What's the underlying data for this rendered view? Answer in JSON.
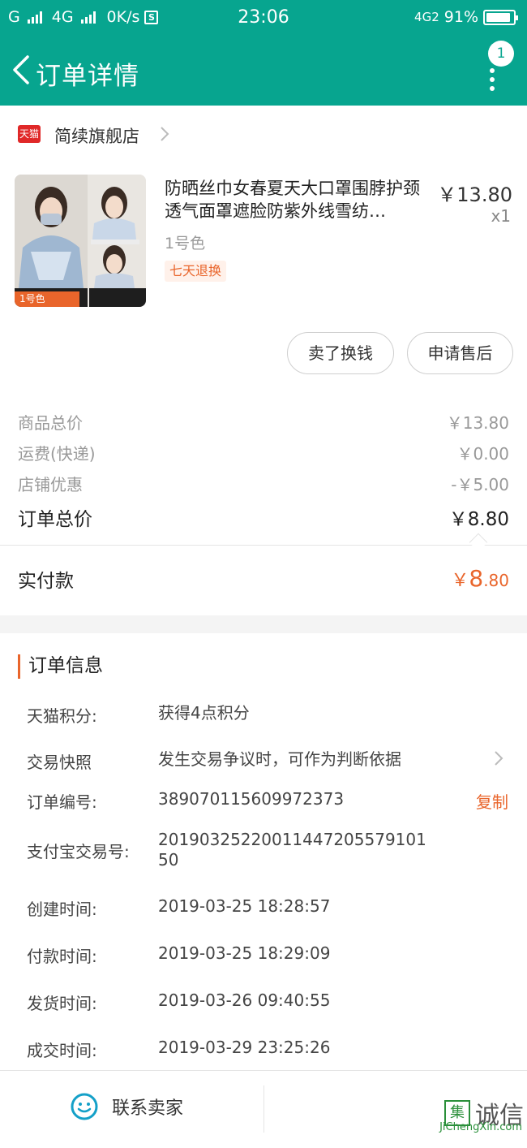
{
  "status": {
    "carrier1": "G",
    "carrier2": "4G",
    "speed": "0K/s",
    "sim_icon_label": "S",
    "time": "23:06",
    "net": "4G2",
    "battery": "91%",
    "battery_level": 0.91
  },
  "header": {
    "title": "订单详情",
    "badge": "1"
  },
  "shop": {
    "logo_text": "天猫",
    "name": "简续旗舰店"
  },
  "product": {
    "image_tag": "1号色",
    "title": "防晒丝巾女春夏天大口罩围脖护颈透气面罩遮脸防紫外线雪纺…",
    "price": "￥13.80",
    "qty": "x1",
    "sku": "1号色",
    "tag": "七天退换"
  },
  "actions": {
    "sell": "卖了换钱",
    "after_sale": "申请售后"
  },
  "summary": [
    {
      "label": "商品总价",
      "value": "￥13.80"
    },
    {
      "label": "运费(快递)",
      "value": "￥0.00"
    },
    {
      "label": "店铺优惠",
      "value": "-￥5.00"
    }
  ],
  "order_total": {
    "label": "订单总价",
    "value": "￥8.80"
  },
  "paid": {
    "label": "实付款",
    "symbol": "￥",
    "integer": "8",
    "decimal": ".80"
  },
  "order_info": {
    "heading": "订单信息",
    "points_label": "天猫积分:",
    "points_value": "获得4点积分",
    "snapshot_label": "交易快照",
    "snapshot_value": "发生交易争议时，可作为判断依据",
    "order_no_label": "订单编号:",
    "order_no_value": "389070115609972373",
    "copy_label": "复制",
    "alipay_label": "支付宝交易号:",
    "alipay_value": "2019032522001144720557910150",
    "created_label": "创建时间:",
    "created_value": "2019-03-25 18:28:57",
    "paid_label": "付款时间:",
    "paid_value": "2019-03-25 18:29:09",
    "shipped_label": "发货时间:",
    "shipped_value": "2019-03-26 09:40:55",
    "done_label": "成交时间:",
    "done_value": "2019-03-29 23:25:26"
  },
  "bottom": {
    "contact": "联系卖家"
  },
  "watermark": {
    "box": "集",
    "text": "诚信",
    "url": "JiChengXin.com"
  },
  "colors": {
    "header": "#07a58f",
    "accent": "#e9652b",
    "tmall": "#e02828"
  }
}
